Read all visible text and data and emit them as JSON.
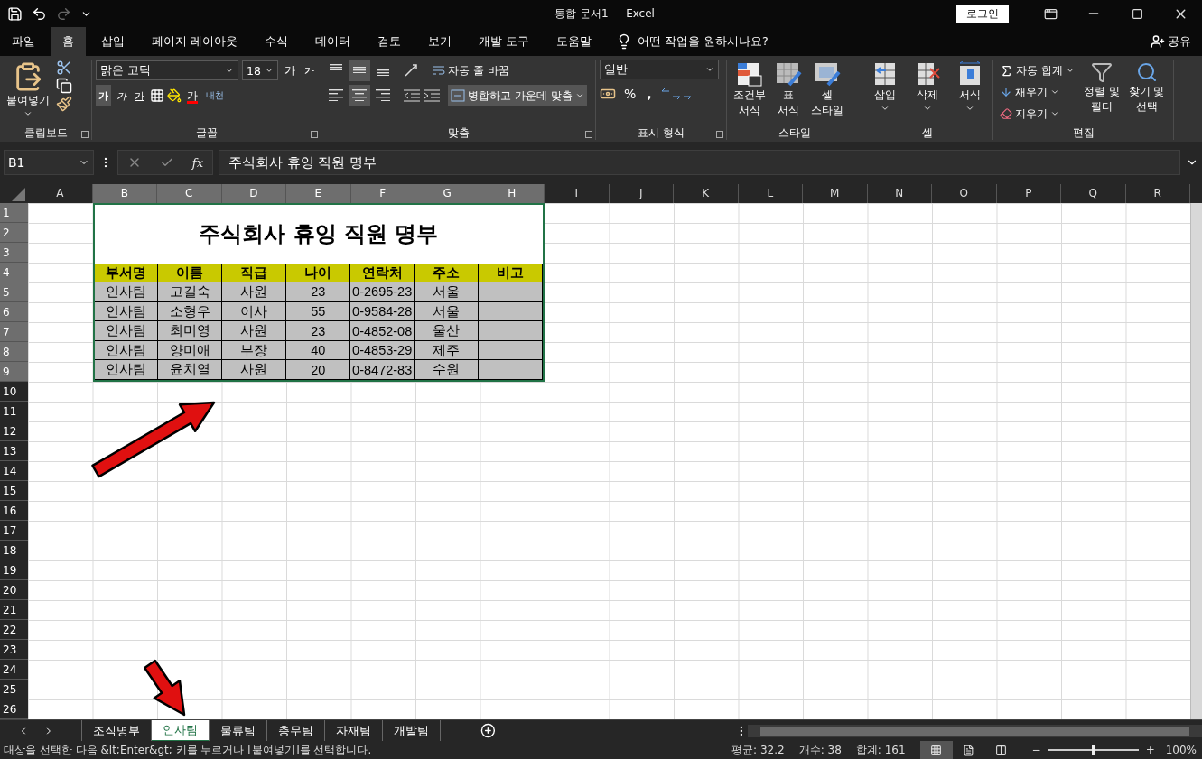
{
  "title_bar": {
    "title": "통합 문서1  -  Excel",
    "login_button": "로그인"
  },
  "menu_tabs": [
    {
      "label": "파일",
      "selected": false
    },
    {
      "label": "홈",
      "selected": true
    },
    {
      "label": "삽입",
      "selected": false
    },
    {
      "label": "페이지 레이아웃",
      "selected": false
    },
    {
      "label": "수식",
      "selected": false
    },
    {
      "label": "데이터",
      "selected": false
    },
    {
      "label": "검토",
      "selected": false
    },
    {
      "label": "보기",
      "selected": false
    },
    {
      "label": "개발 도구",
      "selected": false
    },
    {
      "label": "도움말",
      "selected": false
    }
  ],
  "tell_me": "어떤 작업을 원하시나요?",
  "share": "공유",
  "ribbon": {
    "clipboard": {
      "paste": "붙여넣기",
      "label": "클립보드"
    },
    "font": {
      "name": "맑은 고딕",
      "size": "18",
      "grow": "가",
      "shrink": "가",
      "bold": "가",
      "italic": "가",
      "underline": "가",
      "font_color": "가",
      "phonetic": "내천",
      "label": "글꼴"
    },
    "alignment": {
      "vertical": [
        {
          "selected": false
        },
        {
          "selected": true
        },
        {
          "selected": false
        }
      ],
      "horizontal": [
        {
          "selected": false
        },
        {
          "selected": true
        },
        {
          "selected": false
        }
      ],
      "wrap": "자동 줄 바꿈",
      "merge": "병합하고 가운데 맞춤",
      "label": "맞춤"
    },
    "number": {
      "format": "일반",
      "percent": "%",
      "comma": ",",
      "label": "표시 형식"
    },
    "styles": {
      "items": [
        {
          "lines": [
            "조건부",
            "서식"
          ],
          "kind": "conditional"
        },
        {
          "lines": [
            "표",
            "서식"
          ],
          "kind": "table"
        },
        {
          "lines": [
            "셀",
            "스타일"
          ],
          "kind": "cell"
        }
      ],
      "label": "스타일"
    },
    "cells": {
      "items": [
        {
          "label": "삽입",
          "kind": "insert"
        },
        {
          "label": "삭제",
          "kind": "delete"
        },
        {
          "label": "서식",
          "kind": "format"
        }
      ],
      "label": "셀"
    },
    "editing": {
      "autosum": "자동 합계",
      "fill": "채우기",
      "clear": "지우기",
      "sort": [
        "정렬 및",
        "필터"
      ],
      "find": [
        "찾기 및",
        "선택"
      ],
      "label": "편집"
    }
  },
  "formula_bar": {
    "name_box": "B1",
    "function_label": "fx",
    "formula": "주식회사 휴잉 직원 명부"
  },
  "columns": [
    {
      "label": "A",
      "selected": false
    },
    {
      "label": "B",
      "selected": true
    },
    {
      "label": "C",
      "selected": true
    },
    {
      "label": "D",
      "selected": true
    },
    {
      "label": "E",
      "selected": true
    },
    {
      "label": "F",
      "selected": true
    },
    {
      "label": "G",
      "selected": true
    },
    {
      "label": "H",
      "selected": true
    },
    {
      "label": "I",
      "selected": false
    },
    {
      "label": "J",
      "selected": false
    },
    {
      "label": "K",
      "selected": false
    },
    {
      "label": "L",
      "selected": false
    },
    {
      "label": "M",
      "selected": false
    },
    {
      "label": "N",
      "selected": false
    },
    {
      "label": "O",
      "selected": false
    },
    {
      "label": "P",
      "selected": false
    },
    {
      "label": "Q",
      "selected": false
    },
    {
      "label": "R",
      "selected": false
    }
  ],
  "rows": [
    {
      "label": "1",
      "selected": true
    },
    {
      "label": "2",
      "selected": true
    },
    {
      "label": "3",
      "selected": true
    },
    {
      "label": "4",
      "selected": true
    },
    {
      "label": "5",
      "selected": true
    },
    {
      "label": "6",
      "selected": true
    },
    {
      "label": "7",
      "selected": true
    },
    {
      "label": "8",
      "selected": true
    },
    {
      "label": "9",
      "selected": true
    },
    {
      "label": "10",
      "selected": false
    },
    {
      "label": "11",
      "selected": false
    },
    {
      "label": "12",
      "selected": false
    },
    {
      "label": "13",
      "selected": false
    },
    {
      "label": "14",
      "selected": false
    },
    {
      "label": "15",
      "selected": false
    },
    {
      "label": "16",
      "selected": false
    },
    {
      "label": "17",
      "selected": false
    },
    {
      "label": "18",
      "selected": false
    },
    {
      "label": "19",
      "selected": false
    },
    {
      "label": "20",
      "selected": false
    },
    {
      "label": "21",
      "selected": false
    },
    {
      "label": "22",
      "selected": false
    },
    {
      "label": "23",
      "selected": false
    },
    {
      "label": "24",
      "selected": false
    },
    {
      "label": "25",
      "selected": false
    },
    {
      "label": "26",
      "selected": false
    }
  ],
  "table": {
    "title": "주식회사 휴잉 직원 명부",
    "headers": [
      "부서명",
      "이름",
      "직급",
      "나이",
      "연락처",
      "주소",
      "비고"
    ],
    "rows": [
      [
        "인사팀",
        "고길숙",
        "사원",
        "23",
        "0-2695-23",
        "서울"
      ],
      [
        "인사팀",
        "소형우",
        "이사",
        "55",
        "0-9584-28",
        "서울"
      ],
      [
        "인사팀",
        "최미영",
        "사원",
        "23",
        "0-4852-08",
        "울산"
      ],
      [
        "인사팀",
        "양미애",
        "부장",
        "40",
        "0-4853-29",
        "제주"
      ],
      [
        "인사팀",
        "윤치열",
        "사원",
        "20",
        "0-8472-83",
        "수원"
      ]
    ]
  },
  "sheet_tabs": [
    {
      "label": "조직명부",
      "selected": false
    },
    {
      "label": "인사팀",
      "selected": true
    },
    {
      "label": "물류팀",
      "selected": false
    },
    {
      "label": "총무팀",
      "selected": false
    },
    {
      "label": "자재팀",
      "selected": false
    },
    {
      "label": "개발팀",
      "selected": false
    }
  ],
  "status_bar": {
    "message": "대상을 선택한 다음 &lt;Enter&gt; 키를 누르거나 [붙여넣기]를 선택합니다.",
    "average": "평균: 32.2",
    "count": "개수: 38",
    "sum": "합계: 161",
    "views": [
      {
        "kind": "normal",
        "selected": true
      },
      {
        "kind": "page_layout",
        "selected": false
      },
      {
        "kind": "page_break",
        "selected": false
      }
    ],
    "zoom": {
      "minus": "−",
      "plus": "+",
      "level": 0.5,
      "reading": "100%"
    }
  }
}
